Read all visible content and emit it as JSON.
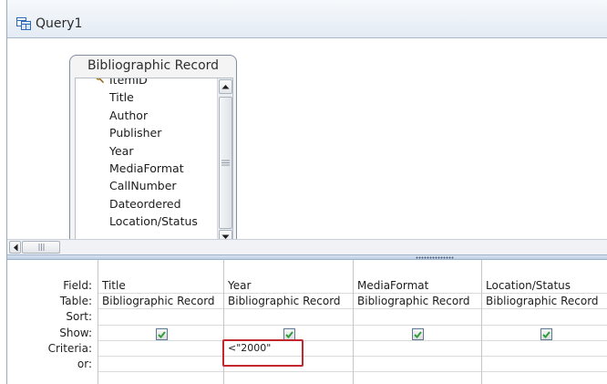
{
  "tab": {
    "title": "Query1"
  },
  "field_list": {
    "title": "Bibliographic Record",
    "items": [
      "ItemID",
      "Title",
      "Author",
      "Publisher",
      "Year",
      "MediaFormat",
      "CallNumber",
      "Dateordered",
      "Location/Status"
    ]
  },
  "grid": {
    "row_labels": {
      "field": "Field:",
      "table": "Table:",
      "sort": "Sort:",
      "show": "Show:",
      "criteria": "Criteria:",
      "or": "or:"
    },
    "columns": [
      {
        "field": "Title",
        "table": "Bibliographic Record",
        "sort": "",
        "show": true,
        "criteria": "",
        "or": ""
      },
      {
        "field": "Year",
        "table": "Bibliographic Record",
        "sort": "",
        "show": true,
        "criteria": "<\"2000\"",
        "or": ""
      },
      {
        "field": "MediaFormat",
        "table": "Bibliographic Record",
        "sort": "",
        "show": true,
        "criteria": "",
        "or": ""
      },
      {
        "field": "Location/Status",
        "table": "Bibliographic Record",
        "sort": "",
        "show": true,
        "criteria": "",
        "or": ""
      }
    ]
  },
  "colors": {
    "highlight": "#c1272d",
    "checkmark": "#2e9e3a",
    "tab_icon": "#2a6ab8"
  }
}
